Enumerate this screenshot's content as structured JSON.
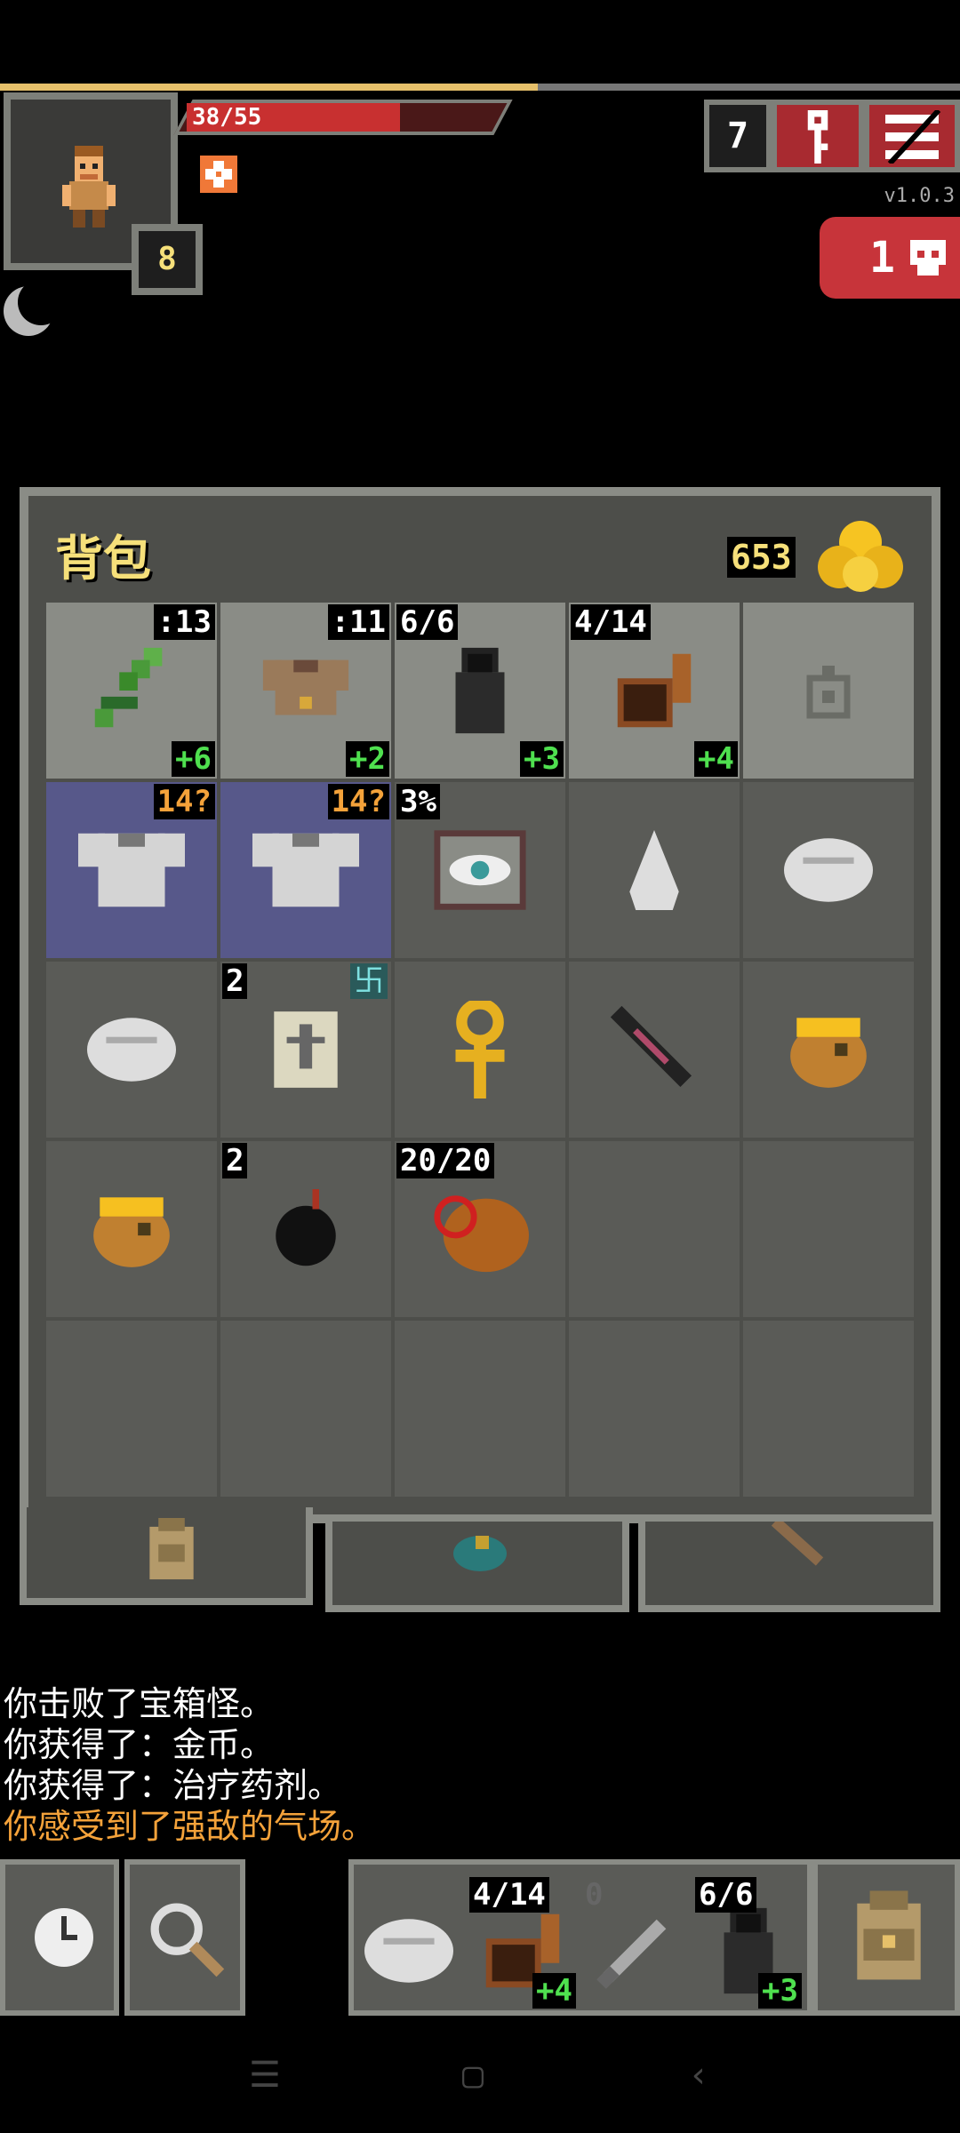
{
  "hud": {
    "hp_text": "38/55",
    "hp_fraction": 0.69,
    "xp_fraction": 0.56,
    "level": "8",
    "depth": "7",
    "version": "v1.0.3",
    "danger_count": "1",
    "icons": [
      "hero-portrait",
      "buff-icon",
      "moon-icon",
      "key-icon",
      "menu-icon",
      "skull-icon"
    ]
  },
  "bag": {
    "title": "背包",
    "gold": "653",
    "slots": [
      {
        "icon": "sword-icon",
        "tr": ":13",
        "br": "+6"
      },
      {
        "icon": "armor-icon",
        "tr": ":11",
        "br": "+2"
      },
      {
        "icon": "cloak-icon",
        "tl": "6/6",
        "br": "+3"
      },
      {
        "icon": "horn-icon",
        "tl": "4/14",
        "br": "+4"
      },
      {
        "icon": "ring-slot-empty-icon"
      },
      {
        "icon": "chainmail-icon",
        "tr": "14?",
        "tr_orange": true
      },
      {
        "icon": "chainmail-icon",
        "tr": "14?",
        "tr_orange": true
      },
      {
        "icon": "eye-tome-icon",
        "tl": "3%"
      },
      {
        "icon": "stone-icon"
      },
      {
        "icon": "food-icon"
      },
      {
        "icon": "food-icon"
      },
      {
        "icon": "scroll-icon",
        "tl": "2",
        "rune": "卐"
      },
      {
        "icon": "ankh-icon"
      },
      {
        "icon": "wand-icon"
      },
      {
        "icon": "honey-pot-icon"
      },
      {
        "icon": "honey-pot-icon"
      },
      {
        "icon": "bomb-icon",
        "tl": "2"
      },
      {
        "icon": "horn-bag-icon",
        "tl": "20/20"
      },
      {},
      {},
      {},
      {},
      {},
      {},
      {}
    ]
  },
  "log": [
    {
      "text": "你击败了宝箱怪。",
      "color": "#ffffff"
    },
    {
      "text": "你获得了：金币。",
      "color": "#ffffff"
    },
    {
      "text": "你获得了：治疗药剂。",
      "color": "#ffffff"
    },
    {
      "text": "你感受到了强敌的气场。",
      "color": "#f4a23a"
    }
  ],
  "toolbar": {
    "quickslots": [
      {
        "icon": "food-icon"
      },
      {
        "icon": "horn-icon",
        "tl": "4/14",
        "br": "+4"
      },
      {
        "icon": "dagger-icon",
        "tl": "0"
      },
      {
        "icon": "cloak-icon",
        "tl": "6/6",
        "br": "+3"
      }
    ],
    "icons": [
      "wait-clock-icon",
      "search-icon",
      "backpack-icon"
    ]
  }
}
